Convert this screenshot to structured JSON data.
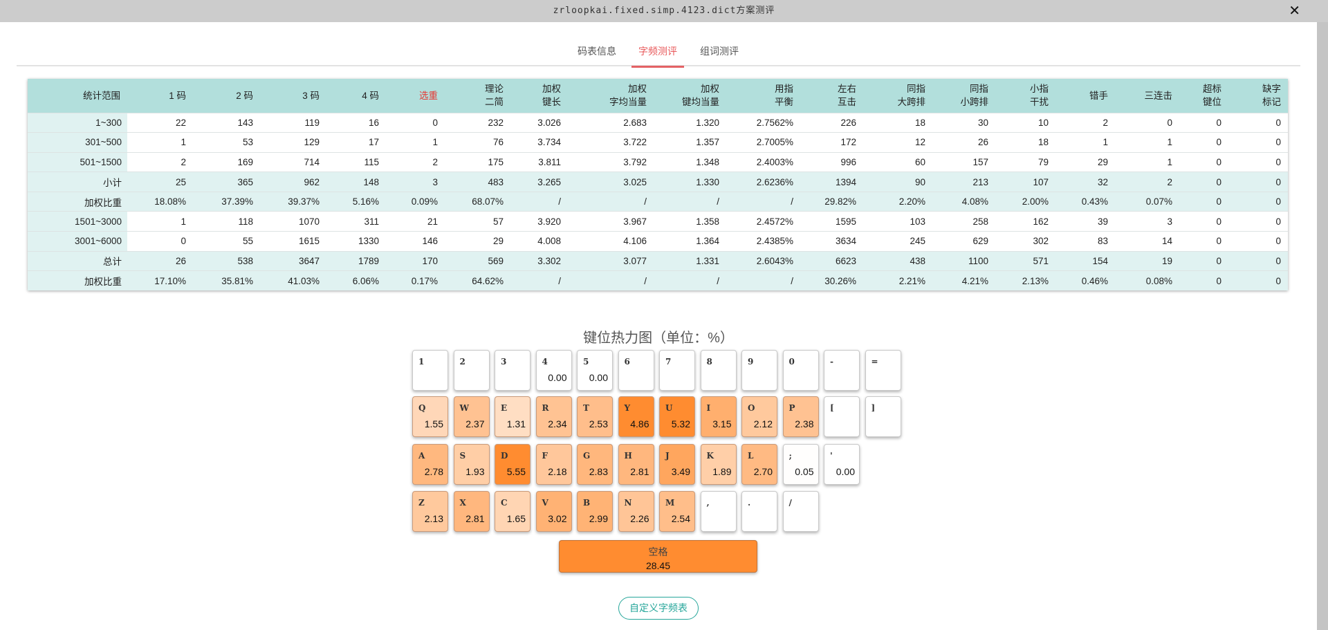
{
  "window": {
    "title": "zrloopkai.fixed.simp.4123.dict方案测评",
    "close_icon": "close-icon"
  },
  "tabs": [
    {
      "label": "码表信息",
      "active": false
    },
    {
      "label": "字频测评",
      "active": true
    },
    {
      "label": "组词测评",
      "active": false
    }
  ],
  "table": {
    "headers": [
      [
        "统计范围"
      ],
      [
        "1 码"
      ],
      [
        "2 码"
      ],
      [
        "3 码"
      ],
      [
        "4 码"
      ],
      [
        "选重"
      ],
      [
        "理论",
        "二简"
      ],
      [
        "加权",
        "键长"
      ],
      [
        "加权",
        "字均当量"
      ],
      [
        "加权",
        "键均当量"
      ],
      [
        "用指",
        "平衡"
      ],
      [
        "左右",
        "互击"
      ],
      [
        "同指",
        "大跨排"
      ],
      [
        "同指",
        "小跨排"
      ],
      [
        "小指",
        "干扰"
      ],
      [
        "错手"
      ],
      [
        "三连击"
      ],
      [
        "超标",
        "键位"
      ],
      [
        "缺字",
        "标记"
      ]
    ],
    "highlight_header_color": "#e53935",
    "rows": [
      {
        "shaded": false,
        "cells": [
          "1~300",
          "22",
          "143",
          "119",
          "16",
          "0",
          "232",
          "3.026",
          "2.683",
          "1.320",
          "2.7562%",
          "226",
          "18",
          "30",
          "10",
          "2",
          "0",
          "0",
          "0"
        ]
      },
      {
        "shaded": false,
        "cells": [
          "301~500",
          "1",
          "53",
          "129",
          "17",
          "1",
          "76",
          "3.734",
          "3.722",
          "1.357",
          "2.7005%",
          "172",
          "12",
          "26",
          "18",
          "1",
          "1",
          "0",
          "0"
        ]
      },
      {
        "shaded": false,
        "cells": [
          "501~1500",
          "2",
          "169",
          "714",
          "115",
          "2",
          "175",
          "3.811",
          "3.792",
          "1.348",
          "2.4003%",
          "996",
          "60",
          "157",
          "79",
          "29",
          "1",
          "0",
          "0"
        ]
      },
      {
        "shaded": true,
        "cells": [
          "小计",
          "25",
          "365",
          "962",
          "148",
          "3",
          "483",
          "3.265",
          "3.025",
          "1.330",
          "2.6236%",
          "1394",
          "90",
          "213",
          "107",
          "32",
          "2",
          "0",
          "0"
        ]
      },
      {
        "shaded": true,
        "cells": [
          "加权比重",
          "18.08%",
          "37.39%",
          "39.37%",
          "5.16%",
          "0.09%",
          "68.07%",
          "/",
          "/",
          "/",
          "/",
          "29.82%",
          "2.20%",
          "4.08%",
          "2.00%",
          "0.43%",
          "0.07%",
          "0",
          "0"
        ]
      },
      {
        "shaded": false,
        "cells": [
          "1501~3000",
          "1",
          "118",
          "1070",
          "311",
          "21",
          "57",
          "3.920",
          "3.967",
          "1.358",
          "2.4572%",
          "1595",
          "103",
          "258",
          "162",
          "39",
          "3",
          "0",
          "0"
        ]
      },
      {
        "shaded": false,
        "cells": [
          "3001~6000",
          "0",
          "55",
          "1615",
          "1330",
          "146",
          "29",
          "4.008",
          "4.106",
          "1.364",
          "2.4385%",
          "3634",
          "245",
          "629",
          "302",
          "83",
          "14",
          "0",
          "0"
        ]
      },
      {
        "shaded": true,
        "cells": [
          "总计",
          "26",
          "538",
          "3647",
          "1789",
          "170",
          "569",
          "3.302",
          "3.077",
          "1.331",
          "2.6043%",
          "6623",
          "438",
          "1100",
          "571",
          "154",
          "19",
          "0",
          "0"
        ]
      },
      {
        "shaded": true,
        "cells": [
          "加权比重",
          "17.10%",
          "35.81%",
          "41.03%",
          "6.06%",
          "0.17%",
          "64.62%",
          "/",
          "/",
          "/",
          "/",
          "30.26%",
          "2.21%",
          "4.21%",
          "2.13%",
          "0.46%",
          "0.08%",
          "0",
          "0"
        ]
      }
    ]
  },
  "heatmap": {
    "title": "键位热力图（单位：%）",
    "max_color": "#ff8c30",
    "rows": [
      [
        {
          "k": "1"
        },
        {
          "k": "2"
        },
        {
          "k": "3"
        },
        {
          "k": "4",
          "v": "0.00"
        },
        {
          "k": "5",
          "v": "0.00"
        },
        {
          "k": "6"
        },
        {
          "k": "7"
        },
        {
          "k": "8"
        },
        {
          "k": "9"
        },
        {
          "k": "0"
        },
        {
          "k": "-"
        },
        {
          "k": "="
        }
      ],
      [
        {
          "k": "Q",
          "v": "1.55"
        },
        {
          "k": "W",
          "v": "2.37"
        },
        {
          "k": "E",
          "v": "1.31"
        },
        {
          "k": "R",
          "v": "2.34"
        },
        {
          "k": "T",
          "v": "2.53"
        },
        {
          "k": "Y",
          "v": "4.86"
        },
        {
          "k": "U",
          "v": "5.32"
        },
        {
          "k": "I",
          "v": "3.15"
        },
        {
          "k": "O",
          "v": "2.12"
        },
        {
          "k": "P",
          "v": "2.38"
        },
        {
          "k": "["
        },
        {
          "k": "]"
        }
      ],
      [
        {
          "k": "A",
          "v": "2.78"
        },
        {
          "k": "S",
          "v": "1.93"
        },
        {
          "k": "D",
          "v": "5.55"
        },
        {
          "k": "F",
          "v": "2.18"
        },
        {
          "k": "G",
          "v": "2.83"
        },
        {
          "k": "H",
          "v": "2.81"
        },
        {
          "k": "J",
          "v": "3.49"
        },
        {
          "k": "K",
          "v": "1.89"
        },
        {
          "k": "L",
          "v": "2.70"
        },
        {
          "k": ";",
          "v": "0.05"
        },
        {
          "k": "'",
          "v": "0.00"
        }
      ],
      [
        {
          "k": "Z",
          "v": "2.13"
        },
        {
          "k": "X",
          "v": "2.81"
        },
        {
          "k": "C",
          "v": "1.65"
        },
        {
          "k": "V",
          "v": "3.02"
        },
        {
          "k": "B",
          "v": "2.99"
        },
        {
          "k": "N",
          "v": "2.26"
        },
        {
          "k": "M",
          "v": "2.54"
        },
        {
          "k": ","
        },
        {
          "k": "."
        },
        {
          "k": "/"
        }
      ]
    ],
    "space": {
      "label": "空格",
      "value": "28.45"
    }
  },
  "custom_button": {
    "label": "自定义字频表"
  }
}
